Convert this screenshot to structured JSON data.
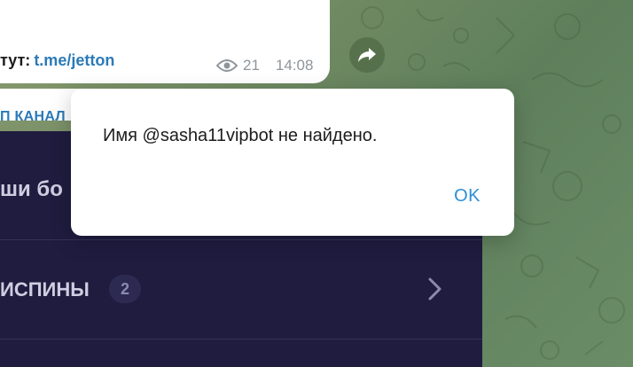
{
  "message": {
    "prefix": "тут:",
    "link": "t.me/jetton",
    "views": "21",
    "time": "14:08"
  },
  "channel": {
    "join_label": "П КАНАЛ"
  },
  "bot_menu": {
    "row1_label": "ши бо",
    "row2_label": "ИСПИНЫ",
    "row2_count": "2"
  },
  "dialog": {
    "message": "Имя @sasha11vipbot не найдено.",
    "ok_label": "OK"
  },
  "colors": {
    "link": "#2b7ab8",
    "dialog_button": "#2b8fd6",
    "dark_panel": "#1f1c3f"
  }
}
